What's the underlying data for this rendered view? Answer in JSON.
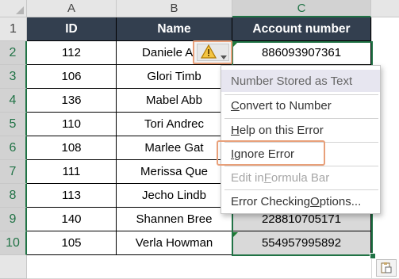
{
  "columns": [
    "A",
    "B",
    "C"
  ],
  "rows": [
    "1",
    "2",
    "3",
    "4",
    "5",
    "6",
    "7",
    "8",
    "9",
    "10"
  ],
  "headers": {
    "id": "ID",
    "name": "Name",
    "account": "Account number"
  },
  "data": [
    {
      "id": "112",
      "name": "Daniele Ang",
      "account": "886093907361"
    },
    {
      "id": "106",
      "name": "Glori Timb",
      "account": ""
    },
    {
      "id": "136",
      "name": "Mabel Abb",
      "account": ""
    },
    {
      "id": "110",
      "name": "Tori Andrec",
      "account": ""
    },
    {
      "id": "108",
      "name": "Marlee Gat",
      "account": ""
    },
    {
      "id": "111",
      "name": "Merissa Que",
      "account": ""
    },
    {
      "id": "113",
      "name": "Jecho Lindb",
      "account": ""
    },
    {
      "id": "140",
      "name": "Shannen Bree",
      "account": "228810705171"
    },
    {
      "id": "105",
      "name": "Verla Howman",
      "account": "554957995892"
    }
  ],
  "menu": {
    "title": "Number Stored as Text",
    "items": [
      {
        "pre": "",
        "u": "C",
        "post": "onvert to Number",
        "disabled": false
      },
      {
        "pre": "",
        "u": "H",
        "post": "elp on this Error",
        "disabled": false
      },
      {
        "pre": "",
        "u": "I",
        "post": "gnore Error",
        "disabled": false
      },
      {
        "pre": "Edit in ",
        "u": "F",
        "post": "ormula Bar",
        "disabled": true
      },
      {
        "pre": "Error Checking ",
        "u": "O",
        "post": "ptions...",
        "disabled": false
      }
    ]
  },
  "icons": {
    "warning": "warning-icon",
    "dropdown": "chevron-down-icon",
    "paste_options": "paste-options-icon"
  },
  "colors": {
    "header_fill": "#333f4f",
    "selection": "#217346",
    "highlight": "#e8a07a",
    "warning": "#e2a400"
  }
}
